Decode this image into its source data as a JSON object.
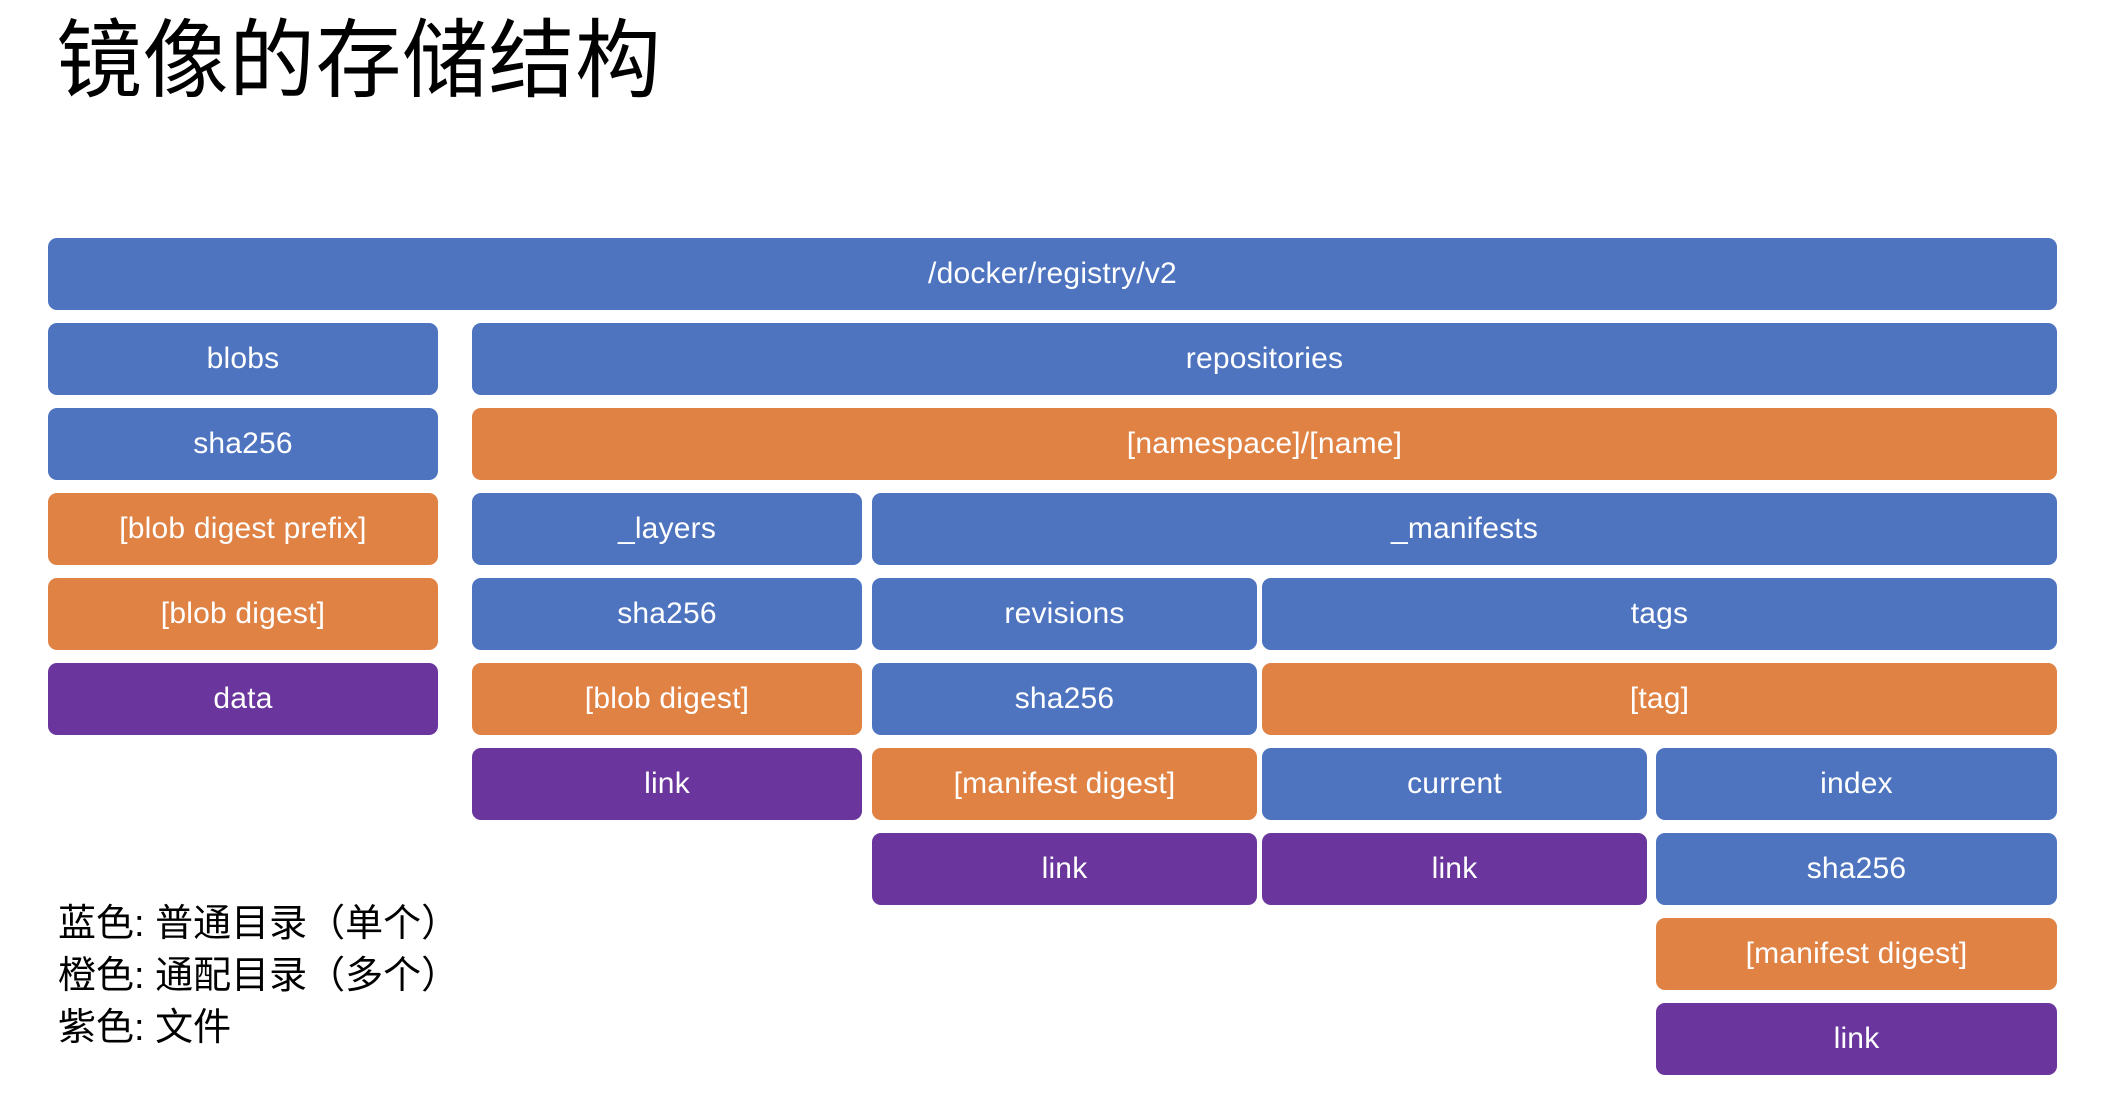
{
  "slide": {
    "title": "镜像的存储结构",
    "background": "#ffffff"
  },
  "colors": {
    "blue": "#4E74C0",
    "orange": "#DF8244",
    "purple": "#6A359C",
    "text": "#ffffff",
    "title_text": "#000000"
  },
  "tree": {
    "root": "/docker/registry/v2",
    "boxes": [
      {
        "label": "/docker/registry/v2",
        "color": "blue"
      },
      {
        "label": "blobs",
        "color": "blue"
      },
      {
        "label": "repositories",
        "color": "blue"
      },
      {
        "label": "sha256",
        "color": "blue"
      },
      {
        "label": "[namespace]/[name]",
        "color": "orange"
      },
      {
        "label": "[blob digest prefix]",
        "color": "orange"
      },
      {
        "label": "_layers",
        "color": "blue"
      },
      {
        "label": "_manifests",
        "color": "blue"
      },
      {
        "label": "[blob digest]",
        "color": "orange"
      },
      {
        "label": "sha256",
        "color": "blue"
      },
      {
        "label": "revisions",
        "color": "blue"
      },
      {
        "label": "tags",
        "color": "blue"
      },
      {
        "label": "data",
        "color": "purple"
      },
      {
        "label": "[blob digest]",
        "color": "orange"
      },
      {
        "label": "sha256",
        "color": "blue"
      },
      {
        "label": "[tag]",
        "color": "orange"
      },
      {
        "label": "link",
        "color": "purple"
      },
      {
        "label": "[manifest digest]",
        "color": "orange"
      },
      {
        "label": "current",
        "color": "blue"
      },
      {
        "label": "index",
        "color": "blue"
      },
      {
        "label": "link",
        "color": "purple"
      },
      {
        "label": "link",
        "color": "purple"
      },
      {
        "label": "sha256",
        "color": "blue"
      },
      {
        "label": "[manifest digest]",
        "color": "orange"
      },
      {
        "label": "link",
        "color": "purple"
      }
    ]
  },
  "legend": {
    "lines": [
      "蓝色: 普通目录（单个）",
      "橙色: 通配目录（多个）",
      "紫色: 文件"
    ]
  }
}
